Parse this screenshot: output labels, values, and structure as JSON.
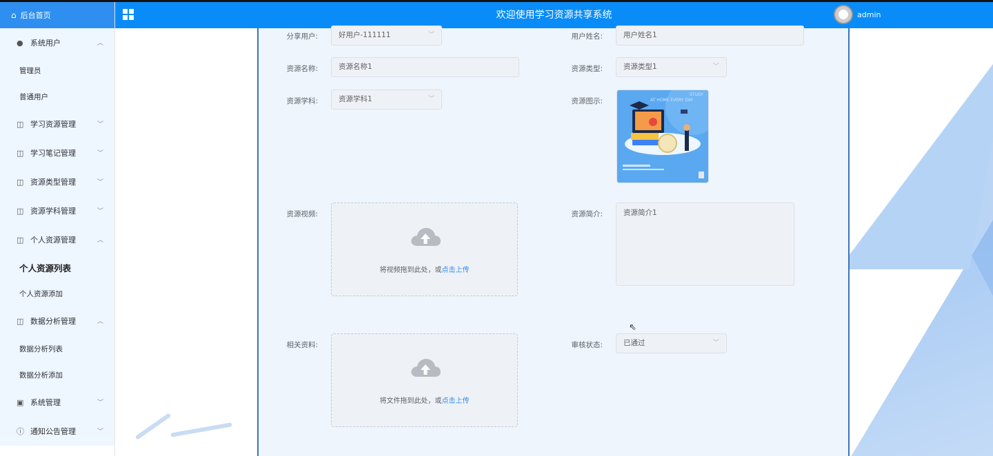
{
  "sidebar": {
    "home_label": "后台首页",
    "groups": [
      {
        "label": "系统用户",
        "open": true,
        "children": [
          "管理员",
          "普通用户"
        ]
      },
      {
        "label": "学习资源管理",
        "open": false,
        "children": []
      },
      {
        "label": "学习笔记管理",
        "open": false,
        "children": []
      },
      {
        "label": "资源类型管理",
        "open": false,
        "children": []
      },
      {
        "label": "资源学科管理",
        "open": false,
        "children": []
      },
      {
        "label": "个人资源管理",
        "open": true,
        "children": [
          "个人资源列表",
          "个人资源添加"
        ]
      },
      {
        "label": "数据分析管理",
        "open": true,
        "children": [
          "数据分析列表",
          "数据分析添加"
        ]
      },
      {
        "label": "系统管理",
        "open": false,
        "children": []
      },
      {
        "label": "通知公告管理",
        "open": false,
        "children": []
      }
    ]
  },
  "header": {
    "title": "欢迎使用学习资源共享系统",
    "user": "admin"
  },
  "form": {
    "share_user_label": "分享用户:",
    "share_user_value": "好用户-111111",
    "user_name_label": "用户姓名:",
    "user_name_value": "用户姓名1",
    "resource_name_label": "资源名称:",
    "resource_name_value": "资源名称1",
    "resource_type_label": "资源类型:",
    "resource_type_value": "资源类型1",
    "resource_subject_label": "资源学科:",
    "resource_subject_value": "资源学科1",
    "resource_image_label": "资源图示:",
    "resource_video_label": "资源视频:",
    "video_upload_text": "将视频拖到此处，或",
    "video_upload_link": "点击上传",
    "resource_intro_label": "资源简介:",
    "resource_intro_value": "资源简介1",
    "related_material_label": "相关资料:",
    "file_upload_text": "将文件拖到此处，或",
    "file_upload_link": "点击上传",
    "audit_status_label": "审核状态:",
    "audit_status_value": "已通过"
  },
  "image_text": {
    "line1": "STUDY",
    "line2": "AT HOME EVERY DAY"
  },
  "colors": {
    "header_bg": "#0a8cf8",
    "sidebar_active_bg": "#2f8ff0",
    "link": "#2f8ff0"
  }
}
